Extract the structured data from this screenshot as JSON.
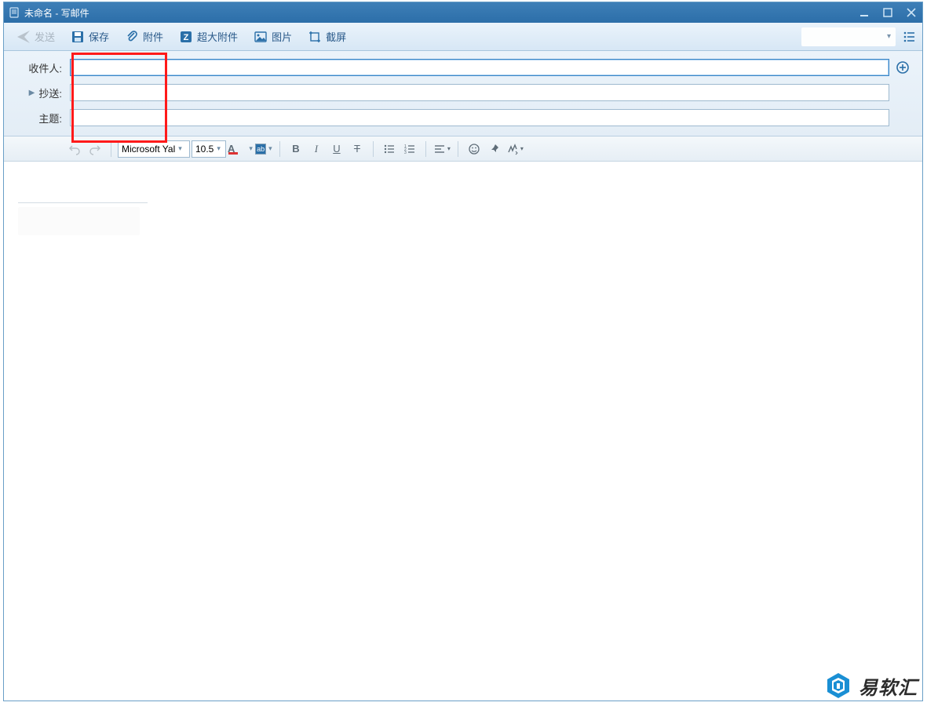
{
  "window": {
    "title": "未命名 - 写邮件"
  },
  "toolbar": {
    "send": "发送",
    "save": "保存",
    "attach": "附件",
    "big_attach": "超大附件",
    "image": "图片",
    "screenshot": "截屏"
  },
  "fields": {
    "recipient_label": "收件人:",
    "cc_label": "抄送:",
    "subject_label": "主题:",
    "recipient_value": "",
    "cc_value": "",
    "subject_value": ""
  },
  "editor": {
    "font_name": "Microsoft Yal",
    "font_size": "10.5",
    "highlight_label": "ab"
  },
  "watermark": {
    "text": "易软汇"
  }
}
